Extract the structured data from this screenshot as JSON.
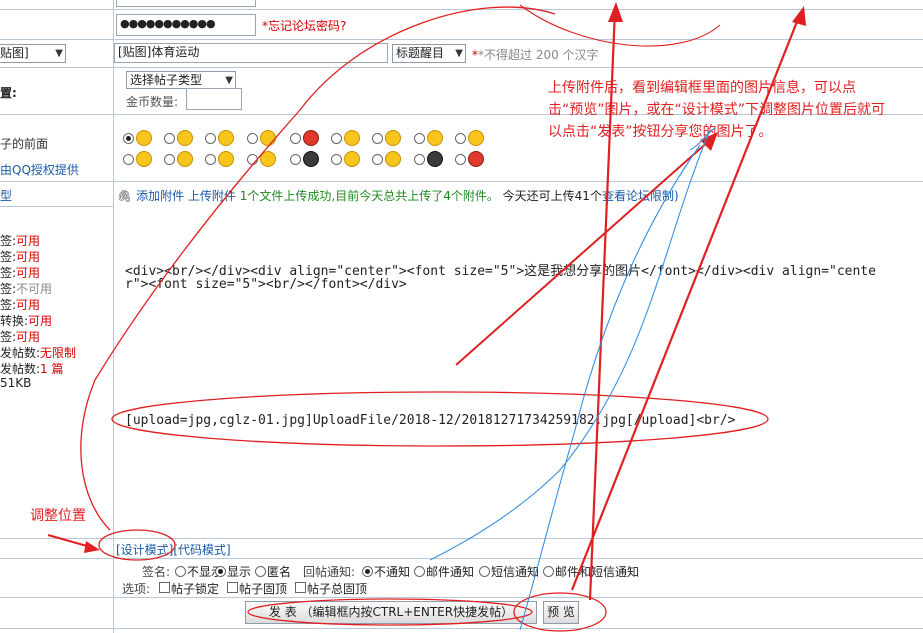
{
  "password": {
    "masked": "●●●●●●●●●●●",
    "forgot_link": "*忘记论坛密码?"
  },
  "title_row": {
    "prefix_select": "贴图]",
    "title_value": "[贴图]体育运动",
    "highlight_select": "标题醒目",
    "limit_note": "*不得超过 200 个汉字"
  },
  "type_row": {
    "label": "置:",
    "type_select": "选择帖子类型",
    "coin_label": "金币数量:"
  },
  "emoticon_row": {
    "label": "子的前面",
    "provider": "由QQ授权提供"
  },
  "attach_row": {
    "label": "型",
    "add_attachment": "添加附件",
    "upload_attachment": "上传附件",
    "status": "1个文件上传成功,目前今天总共上传了4个附件。",
    "remaining_prefix": "今天还可上传41个",
    "view_limit": "查看论坛限制)"
  },
  "permissions": [
    {
      "name": "签:",
      "value": "可用"
    },
    {
      "name": "签:",
      "value": "可用"
    },
    {
      "name": "签:",
      "value": "可用"
    },
    {
      "name": "签:",
      "value": "不可用"
    },
    {
      "name": "签:",
      "value": "可用"
    },
    {
      "name": "转换:",
      "value": "可用"
    },
    {
      "name": "签:",
      "value": "可用"
    },
    {
      "name": "发帖数:",
      "value": "无限制"
    },
    {
      "name": "发帖数:",
      "value": "1 篇"
    },
    {
      "name": "51KB",
      "value": ""
    }
  ],
  "editor": {
    "html_line1": "<div><br/></div><div align=\"center\"><font size=\"5\">这是我想分享的图片</font></div><div align=\"cente",
    "html_line2": "r\"><font size=\"5\"><br/></font></div>",
    "upload_line": "[upload=jpg,cglz-01.jpg]UploadFile/2018-12/20181271734259182.jpg[/upload]<br/>"
  },
  "modes": {
    "design": "[设计模式]",
    "code": "[代码模式]"
  },
  "sign_row": {
    "sign_label": "签名:",
    "hide": "不显示",
    "show": "显示",
    "anon": "匿名",
    "notify_label": "回帖通知:",
    "no_notify": "不通知",
    "mail": "邮件通知",
    "sms": "短信通知",
    "mail_sms": "邮件和短信通知"
  },
  "options_row": {
    "label": "选项:",
    "lock": "帖子锁定",
    "top": "帖子固顶",
    "total_top": "帖子总固顶"
  },
  "buttons": {
    "submit": "发 表 （编辑框内按CTRL+ENTER快捷发帖）",
    "preview": "预 览"
  },
  "annotations": {
    "note": "上传附件后，看到编辑框里面的图片信息，可以点击“预览”图片，或在“设计模式”下调整图片位置后就可以点击“发表”按钮分享您的图片了。",
    "adjust": "调整位置"
  }
}
